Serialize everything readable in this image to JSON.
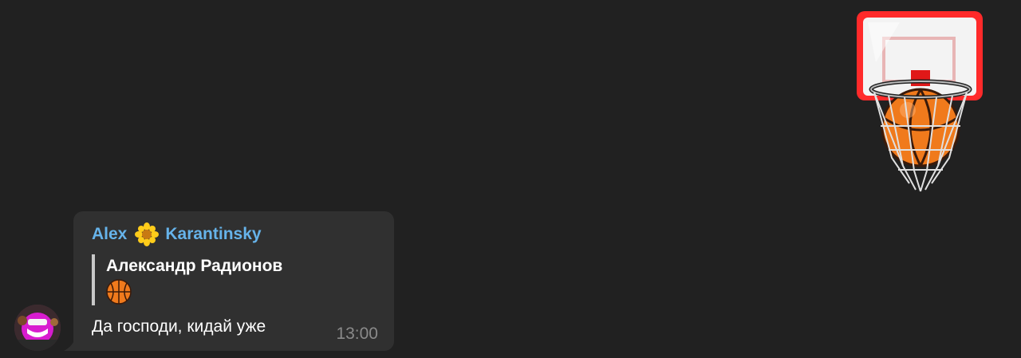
{
  "colors": {
    "background": "#212121",
    "bubble": "#303030",
    "sender_name": "#66b3ea",
    "reply_bar": "#c8c8c8",
    "text": "#ffffff",
    "time": "#8a8a8a"
  },
  "sticker": {
    "icon": "basketball-hoop-sticker"
  },
  "message": {
    "sender_first": "Alex",
    "sender_emoji": "sunflower-icon",
    "sender_last": "Karantinsky",
    "reply": {
      "author": "Александр Радионов",
      "content_icon": "basketball-icon"
    },
    "text": "Да господи, кидай уже",
    "time": "13:00"
  },
  "avatar": {
    "icon": "user-avatar"
  }
}
